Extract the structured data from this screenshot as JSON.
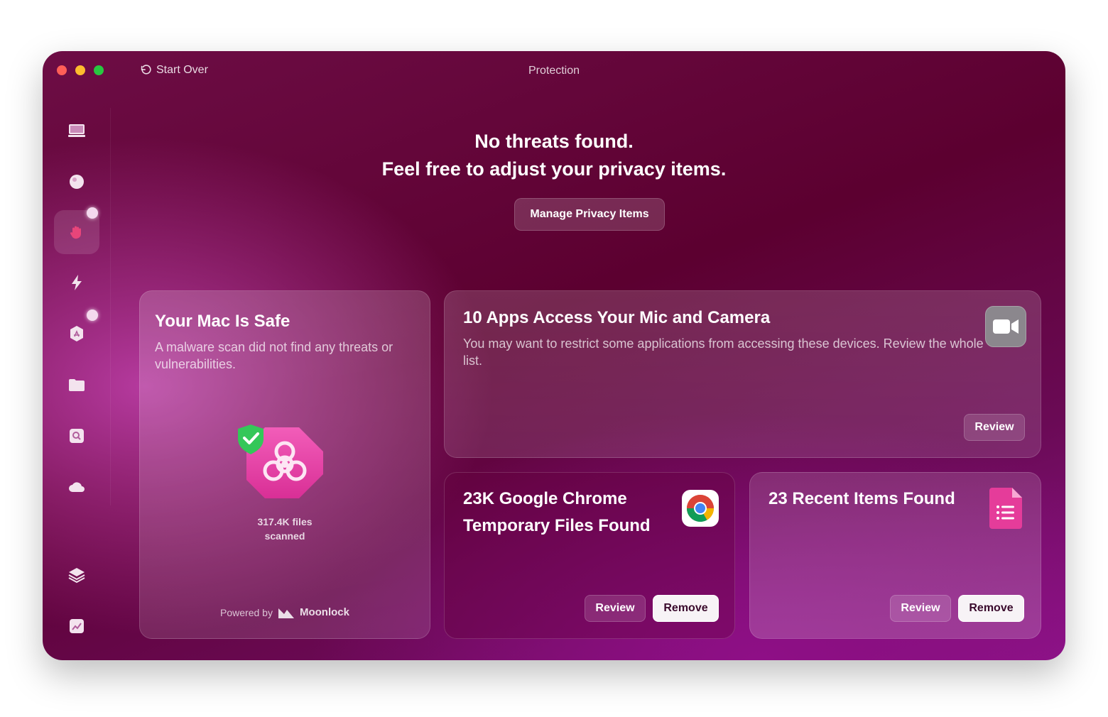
{
  "window": {
    "title": "Protection",
    "start_over_label": "Start Over"
  },
  "sidebar": {
    "items": [
      {
        "id": "smart-scan",
        "icon": "monitor-icon"
      },
      {
        "id": "cleanup",
        "icon": "bubble-icon"
      },
      {
        "id": "protection",
        "icon": "hand-icon",
        "active": true,
        "has_dot": true
      },
      {
        "id": "speed",
        "icon": "bolt-icon"
      },
      {
        "id": "applications",
        "icon": "app-store-icon",
        "has_dot": true
      },
      {
        "id": "my-clutter",
        "icon": "folder-icon"
      },
      {
        "id": "space-lens",
        "icon": "disk-search-icon"
      },
      {
        "id": "cloud-cleanup",
        "icon": "cloud-icon"
      },
      {
        "id": "assistant",
        "icon": "layers-icon"
      },
      {
        "id": "performance",
        "icon": "chart-icon"
      }
    ]
  },
  "header": {
    "line1": "No threats found.",
    "line2": "Feel free to adjust your privacy items.",
    "manage_label": "Manage Privacy Items"
  },
  "cards": {
    "safe": {
      "title": "Your Mac Is Safe",
      "description": "A malware scan did not find any threats or vulnerabilities.",
      "files_line1": "317.4K files",
      "files_line2": "scanned",
      "powered_by": "Powered by",
      "brand": "Moonlock"
    },
    "mic": {
      "title": "10 Apps Access Your Mic and Camera",
      "description": "You may want to restrict some applications from accessing these devices. Review the whole list.",
      "review_label": "Review"
    },
    "chrome": {
      "title_line1": "23K Google Chrome",
      "title_line2": "Temporary Files Found",
      "review_label": "Review",
      "remove_label": "Remove"
    },
    "recent": {
      "title": "23 Recent Items Found",
      "review_label": "Review",
      "remove_label": "Remove"
    }
  },
  "colors": {
    "background_top": "#5c0030",
    "background_bottom": "#8c1388",
    "accent_pink": "#e64aa8",
    "shield_green": "#34c759",
    "close": "#ff5f57",
    "minimize": "#febc2e",
    "zoom": "#28c840"
  }
}
